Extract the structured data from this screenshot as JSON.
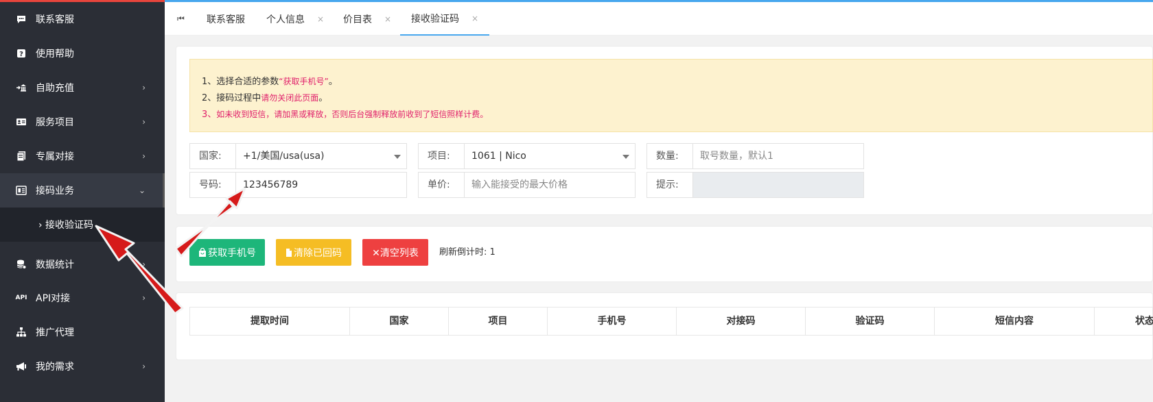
{
  "sidebar": {
    "items": [
      {
        "label": "联系客服",
        "icon": "chat-icon"
      },
      {
        "label": "使用帮助",
        "icon": "help-icon"
      },
      {
        "label": "自助充值",
        "icon": "recharge-icon",
        "arrow": "›"
      },
      {
        "label": "服务项目",
        "icon": "id-card-icon",
        "arrow": "›"
      },
      {
        "label": "专属对接",
        "icon": "document-icon",
        "arrow": "›"
      },
      {
        "label": "接码业务",
        "icon": "code-icon",
        "arrow": "⌄"
      },
      {
        "label": "数据统计",
        "icon": "database-icon",
        "arrow": "›"
      },
      {
        "label": "API对接",
        "icon": "api-icon",
        "icon_text": "API",
        "arrow": "›"
      },
      {
        "label": "推广代理",
        "icon": "sitemap-icon"
      },
      {
        "label": "我的需求",
        "icon": "megaphone-icon",
        "arrow": "›"
      }
    ],
    "sub_item": "› 接收验证码"
  },
  "tabs": {
    "first_icon": "⏮",
    "items": [
      {
        "label": "联系客服",
        "close": ""
      },
      {
        "label": "个人信息",
        "close": "×"
      },
      {
        "label": "价目表",
        "close": "×"
      },
      {
        "label": "接收验证码",
        "close": "×"
      }
    ]
  },
  "notice": {
    "line1_prefix": "1、选择合适的参数",
    "line1_red": "“获取手机号”",
    "line1_suffix": "。",
    "line2_prefix": "2、接码过程中",
    "line2_red": "请勿关闭此页面",
    "line2_suffix": "。",
    "line3_prefix": "3、",
    "line3_red": "如未收到短信，请加黑或释放，否则后台强制释放前收到了短信照样计费。"
  },
  "form": {
    "country_label": "国家:",
    "country_value": "+1/美国/usa(usa)",
    "project_label": "项目:",
    "project_value": "1061 | Nico",
    "quantity_label": "数量:",
    "quantity_placeholder": "取号数量，默认1",
    "number_label": "号码:",
    "number_value": "123456789",
    "price_label": "单价:",
    "price_placeholder": "输入能接受的最大价格",
    "hint_label": "提示:",
    "hint_value": ""
  },
  "actions": {
    "get_number": "获取手机号",
    "clear_received": "清除已回码",
    "clear_list": "✕清空列表",
    "countdown_label": "刷新倒计时:",
    "countdown_value": "1"
  },
  "table": {
    "columns": [
      "提取时间",
      "国家",
      "项目",
      "手机号",
      "对接码",
      "验证码",
      "短信内容",
      "状态"
    ]
  },
  "colors": {
    "sidebar_bg": "#2b2e36",
    "accent_blue": "#47a7ee",
    "green": "#1db67a",
    "yellow": "#f5bd24",
    "red": "#ee4040",
    "arrow_red": "#d61a1a"
  }
}
